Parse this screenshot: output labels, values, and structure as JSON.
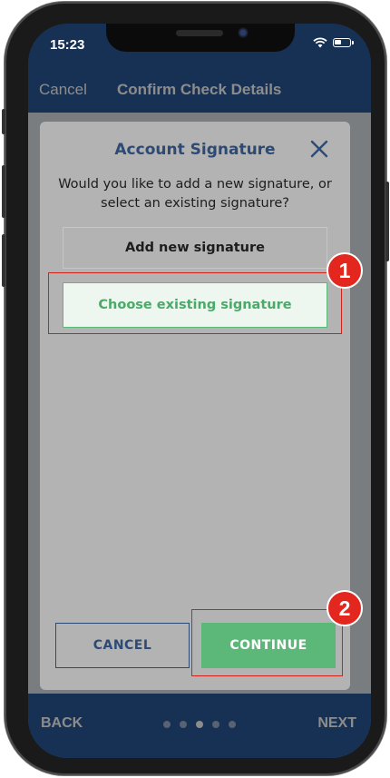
{
  "status_bar": {
    "time": "15:23"
  },
  "nav": {
    "cancel_label": "Cancel",
    "title": "Confirm Check Details"
  },
  "footer": {
    "back_label": "BACK",
    "next_label": "NEXT",
    "page_count": 5,
    "active_page": 3
  },
  "modal": {
    "title": "Account Signature",
    "message": "Would you like to add a new signature, or select an existing signature?",
    "options": [
      {
        "label": "Add new signature"
      },
      {
        "label": "Choose existing signature",
        "selected": true
      }
    ],
    "cancel_label": "CANCEL",
    "continue_label": "CONTINUE"
  },
  "annotations": [
    {
      "label": "1"
    },
    {
      "label": "2"
    }
  ],
  "colors": {
    "app_blue": "#2b5a9a",
    "title_navy": "#2c4a75",
    "accent_green": "#5cb879",
    "annotation_red": "#e3261e"
  }
}
